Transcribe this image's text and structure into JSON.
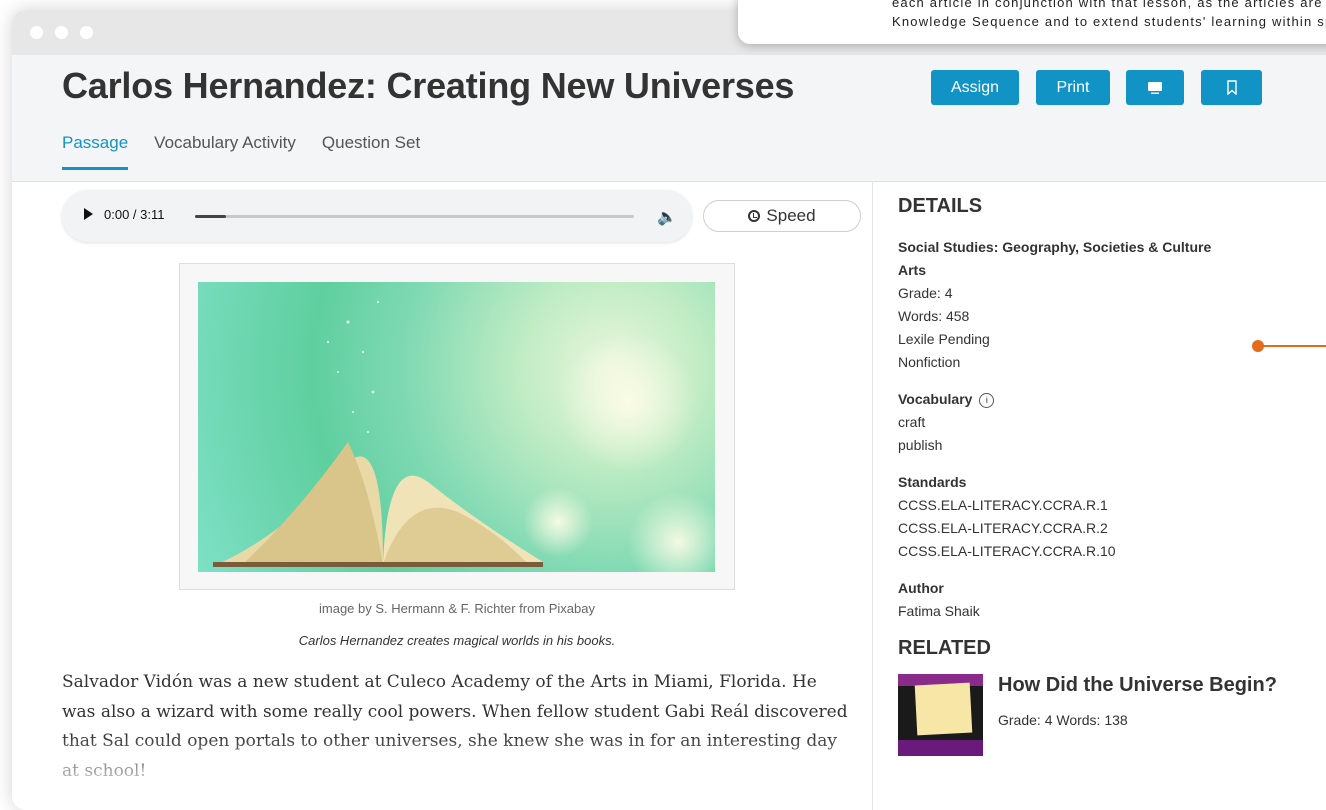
{
  "window": {
    "title_dots": [
      "close",
      "minimize",
      "maximize"
    ]
  },
  "callout": {
    "line1": "each article in conjunction with that lesson, as the articles are s",
    "line2": "Knowledge Sequence and to extend students' learning within sp"
  },
  "header": {
    "title": "Carlos Hernandez: Creating New Universes",
    "buttons": {
      "assign": "Assign",
      "print": "Print"
    },
    "icons": {
      "present": "monitor-icon",
      "bookmark": "bookmark-icon"
    },
    "accent_color": "#1193c5"
  },
  "tabs": [
    {
      "label": "Passage",
      "active": true
    },
    {
      "label": "Vocabulary Activity",
      "active": false
    },
    {
      "label": "Question Set",
      "active": false
    }
  ],
  "audio": {
    "time": "0:00 / 3:11",
    "progress": 0.07,
    "speed_label": "Speed"
  },
  "figure": {
    "credit": "image by S. Hermann & F. Richter from Pixabay",
    "caption": "Carlos Hernandez creates magical worlds in his books."
  },
  "passage": {
    "text": "Salvador Vidón was a new student at Culeco Academy of the Arts in Miami, Florida. He was also a wizard with some really cool powers. When fellow student Gabi Reál discovered that Sal could open portals to other universes, she knew she was in for an interesting day at school!"
  },
  "details": {
    "heading": "DETAILS",
    "subject_line1": "Social Studies: Geography, Societies & Culture",
    "subject_line2": "Arts",
    "grade": "Grade: 4",
    "words": "Words: 458",
    "lexile": "Lexile Pending",
    "genre": "Nonfiction",
    "vocabulary_label": "Vocabulary",
    "vocabulary": [
      "craft",
      "publish"
    ],
    "standards_label": "Standards",
    "standards": [
      "CCSS.ELA-LITERACY.CCRA.R.1",
      "CCSS.ELA-LITERACY.CCRA.R.2",
      "CCSS.ELA-LITERACY.CCRA.R.10"
    ],
    "author_label": "Author",
    "author": "Fatima Shaik"
  },
  "related": {
    "heading": "RELATED",
    "items": [
      {
        "title": "How Did the Universe Begin?",
        "meta": "Grade: 4 Words: 138"
      }
    ]
  },
  "annotation_color": "#e56a1e"
}
